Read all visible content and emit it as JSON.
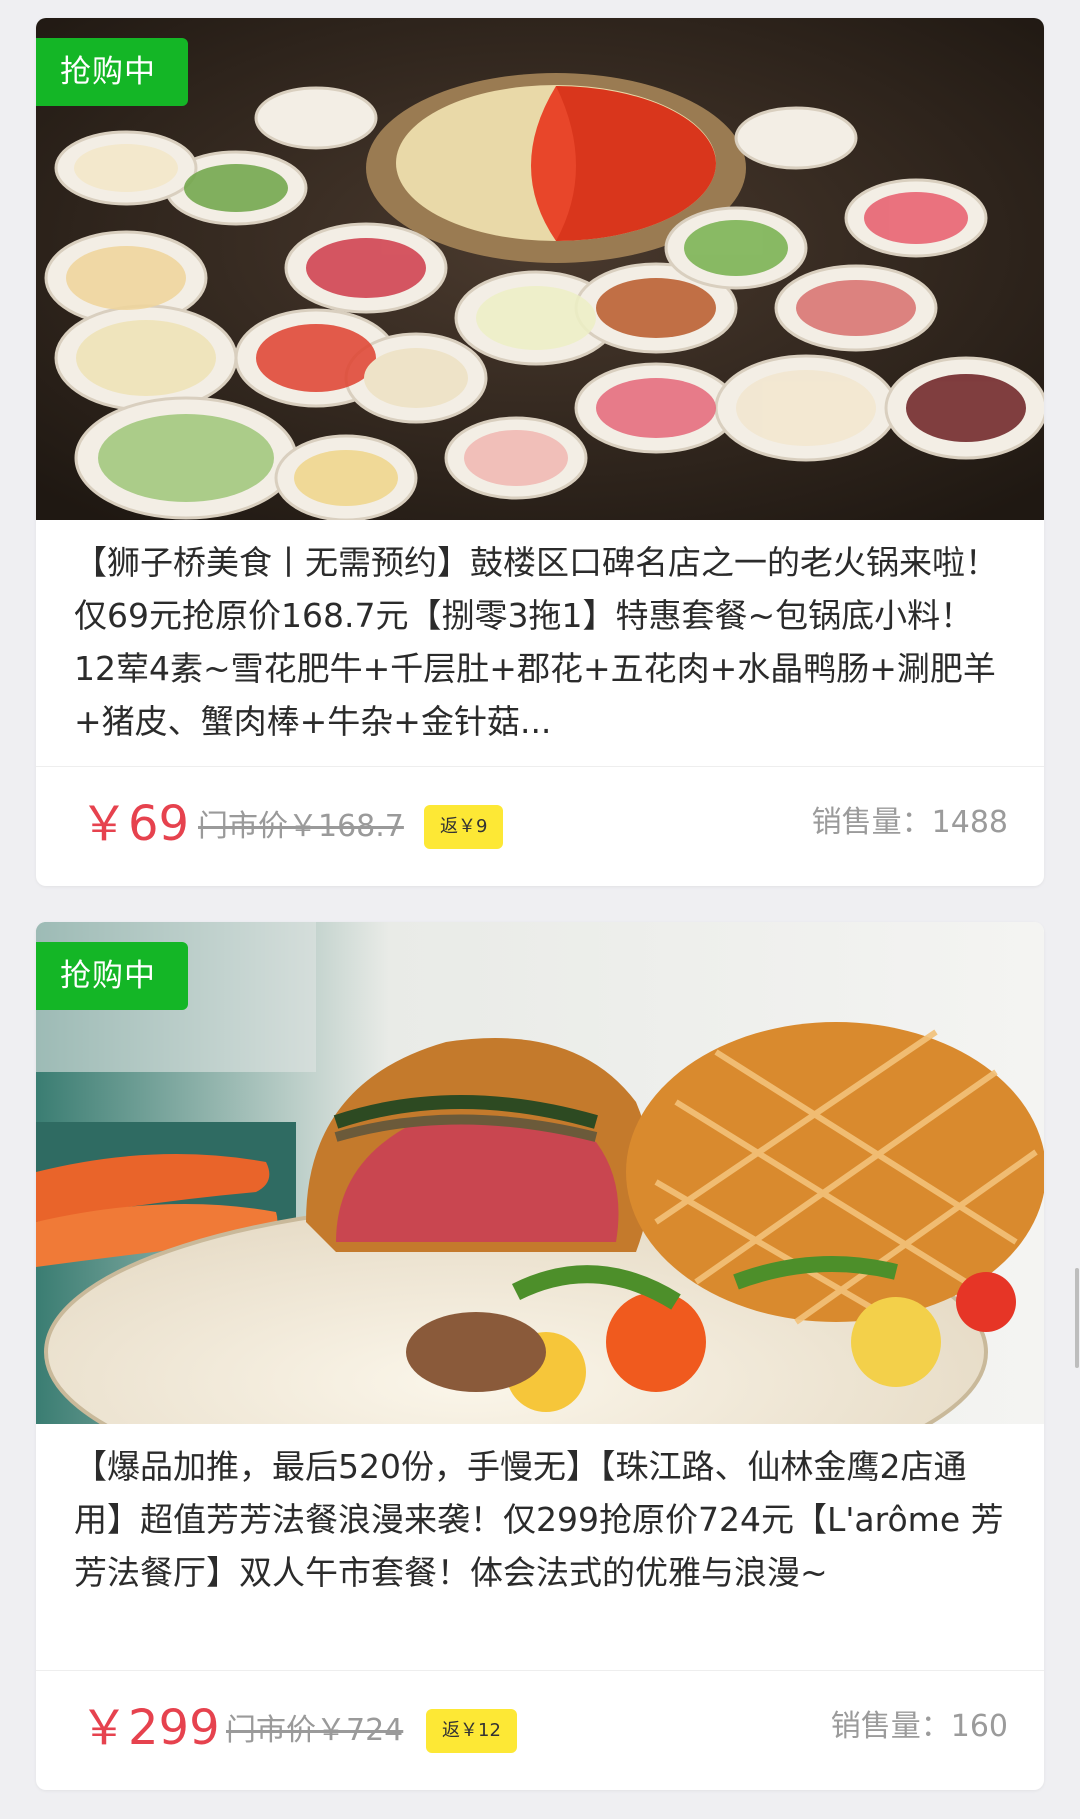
{
  "deals": [
    {
      "badge": "抢购中",
      "image_icon": "hotpot-photo",
      "title": "【狮子桥美食丨无需预约】鼓楼区口碑名店之一的老火锅来啦！仅69元抢原价168.7元【捌零3拖1】特惠套餐~包锅底小料！12荤4素~雪花肥牛+千层肚+郡花+五花肉+水晶鸭肠+涮肥羊+猪皮、蟹肉棒+牛杂+金针菇...",
      "price": "￥69",
      "original_price": "门市价￥168.7",
      "rebate": "返￥9",
      "sales": "销售量：1488"
    },
    {
      "badge": "抢购中",
      "image_icon": "beef-wellington-photo",
      "title": "【爆品加推，最后520份，手慢无】【珠江路、仙林金鹰2店通用】超值芳芳法餐浪漫来袭！仅299抢原价724元【L'arôme 芳芳法餐厅】双人午市套餐！体会法式的优雅与浪漫~",
      "price": "￥299",
      "original_price": "门市价￥724",
      "rebate": "返￥12",
      "sales": "销售量：160"
    }
  ],
  "colors": {
    "badge_green": "#14b626",
    "price_red": "#e6424e",
    "rebate_yellow": "#fde835",
    "muted_gray": "#9a9a9a"
  }
}
